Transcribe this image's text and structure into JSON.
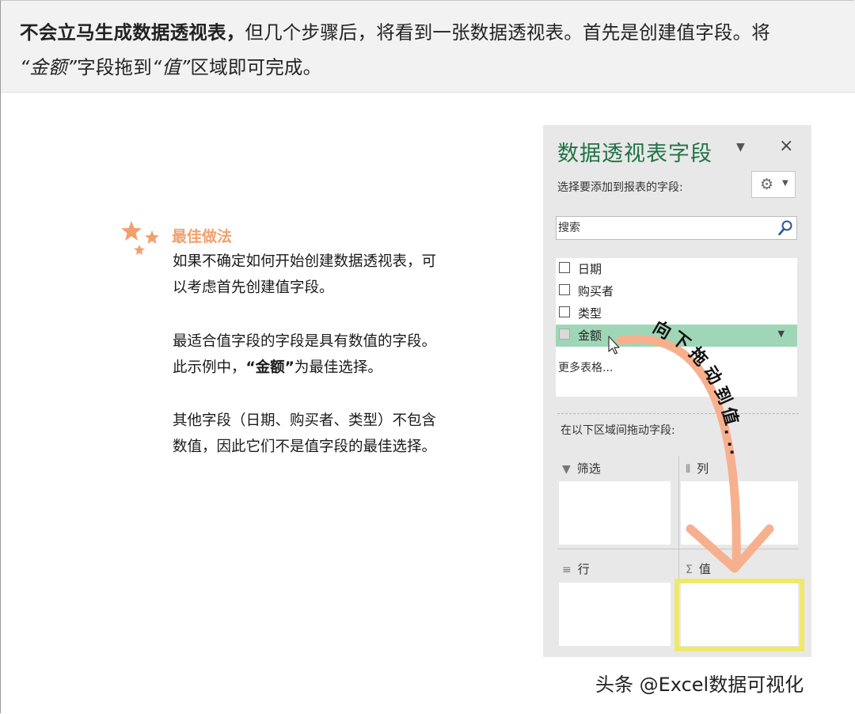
{
  "banner": {
    "bold_part": "不会立马生成数据透视表，",
    "text_part_1": "但几个步骤后，将看到一张数据透视表。首先是创建值字段。将",
    "italic_amount": "“金额”",
    "text_part_2": "字段拖到",
    "italic_value": "“值”",
    "text_part_3": "区域",
    "text_part_4": "即可完成。"
  },
  "tip": {
    "title": "最佳做法",
    "para1": "如果不确定如何开始创建数据透视表，可以考虑首先创建值字段。",
    "para2_a": "最适合值字段的字段是具有数值的字段。此示例中，",
    "para2_bold": "“金额”",
    "para2_b": "为最佳选择。",
    "para3": "其他字段（日期、购买者、类型）不包含数值，因此它们不是值字段的最佳选择。"
  },
  "panel": {
    "title": "数据透视表字段",
    "dropdown_icon": "▼",
    "close_icon": "×",
    "subtitle": "选择要添加到报表的字段:",
    "gear_icon": "⚙",
    "gear_caret": "▼",
    "search_placeholder": "搜索",
    "fields": [
      {
        "label": "日期",
        "checked": false,
        "selected": false
      },
      {
        "label": "购买者",
        "checked": false,
        "selected": false
      },
      {
        "label": "类型",
        "checked": false,
        "selected": false
      },
      {
        "label": "金额",
        "checked": false,
        "selected": true
      }
    ],
    "field_caret": "▼",
    "more_tables": "更多表格...",
    "drag_instruction": "在以下区域间拖动字段:",
    "areas": {
      "filter": {
        "label": "筛选",
        "icon": "▼"
      },
      "columns": {
        "label": "列",
        "icon": "⦀"
      },
      "rows": {
        "label": "行",
        "icon": "≡"
      },
      "values": {
        "label": "值",
        "icon": "Σ"
      }
    }
  },
  "annotation": {
    "drag_text": "向下拖动到值...",
    "arrow_color": "#f7b08e",
    "highlight_color": "#f0e86a"
  },
  "watermark": "头条 @Excel数据可视化",
  "colors": {
    "panel_title": "#217346",
    "selected_row": "#9fd6b7",
    "tip_title": "#f2a06e",
    "banner_bg": "#f2f2f2",
    "panel_bg": "#e8e8e8"
  }
}
